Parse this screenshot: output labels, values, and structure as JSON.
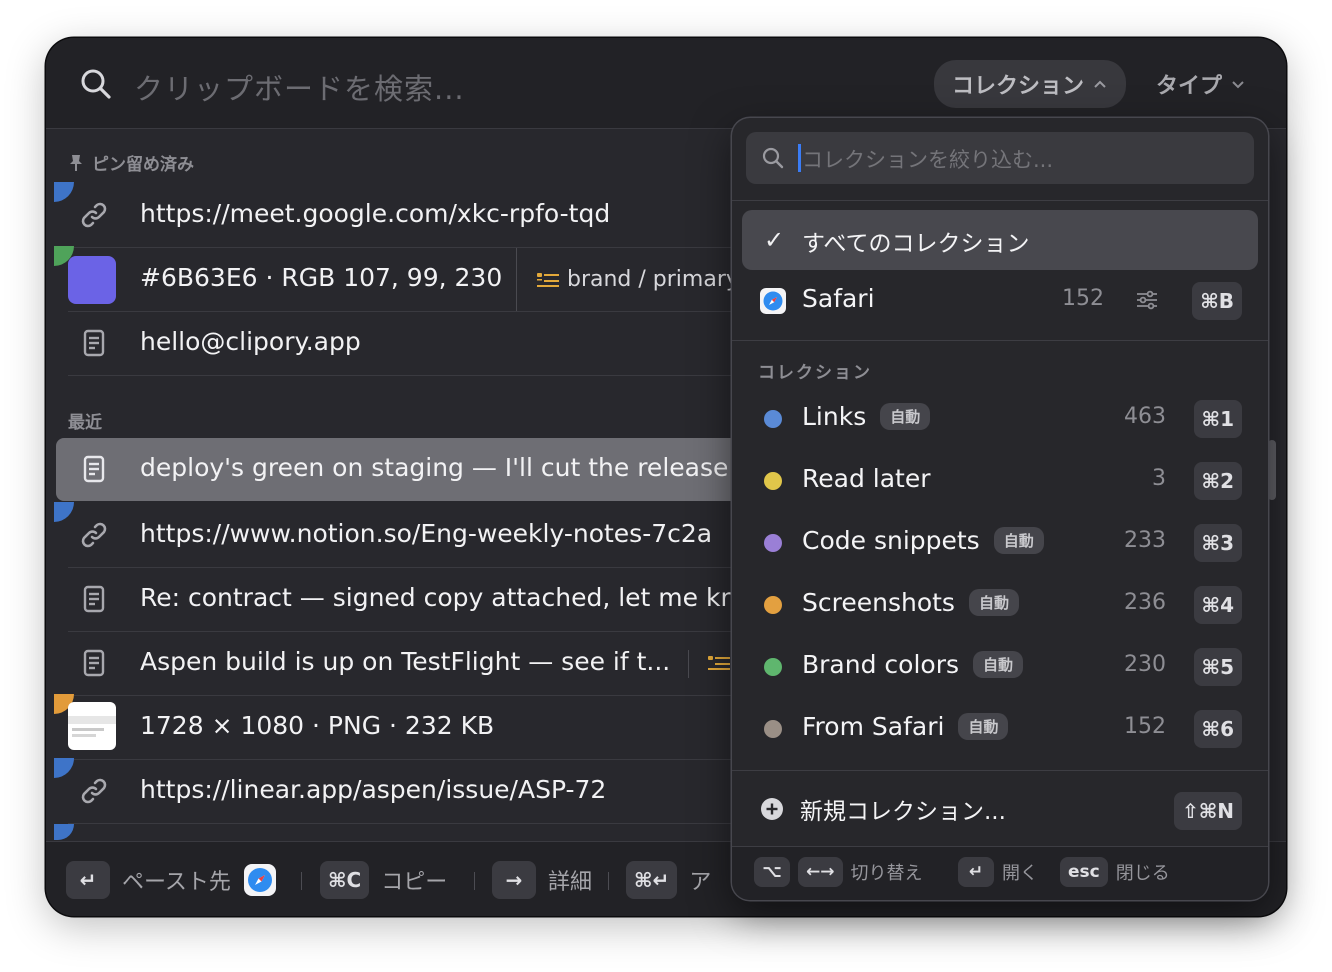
{
  "search": {
    "placeholder": "クリップボードを検索..."
  },
  "header": {
    "collection_label": "コレクション",
    "type_label": "タイプ"
  },
  "pinned": {
    "title": "ピン留め済み",
    "items": [
      {
        "kind": "link",
        "text": "https://meet.google.com/xkc-rpfo-tqd",
        "corner_color": "#3e74c8"
      },
      {
        "kind": "color",
        "text": "#6B63E6 · RGB 107, 99, 230",
        "swatch": "#6B63E6",
        "corner_color": "#4fa35a",
        "collection": "brand / primary"
      },
      {
        "kind": "text",
        "text": "hello@clipory.app"
      }
    ]
  },
  "recent": {
    "title": "最近",
    "items": [
      {
        "kind": "text",
        "text": "deploy's green on staging — I'll cut the release a",
        "selected": true
      },
      {
        "kind": "link",
        "text": "https://www.notion.so/Eng-weekly-notes-7c2a",
        "corner_color": "#3e74c8"
      },
      {
        "kind": "text",
        "text": "Re: contract — signed copy attached, let me kno"
      },
      {
        "kind": "text",
        "text": "Aspen build is up on TestFlight — see if t..."
      },
      {
        "kind": "image",
        "text": "1728 × 1080 · PNG · 232 KB",
        "corner_color": "#e29b3a"
      },
      {
        "kind": "link",
        "text": "https://linear.app/aspen/issue/ASP-72",
        "corner_color": "#3e74c8"
      }
    ]
  },
  "bottombar": {
    "paste_to": "ペースト先",
    "copy_key": "⌘C",
    "copy": "コピー",
    "detail": "詳細",
    "action_key": "⌘↵",
    "action": "ア"
  },
  "dropdown": {
    "filter_placeholder": "コレクションを絞り込む...",
    "all_label": "すべてのコレクション",
    "safari": {
      "name": "Safari",
      "count": "152",
      "key": "⌘B"
    },
    "section_title": "コレクション",
    "collections": [
      {
        "name": "Links",
        "auto": "自動",
        "count": "463",
        "key": "⌘1",
        "color": "#5a8ad6"
      },
      {
        "name": "Read later",
        "auto": "",
        "count": "3",
        "key": "⌘2",
        "color": "#e0c64a"
      },
      {
        "name": "Code snippets",
        "auto": "自動",
        "count": "233",
        "key": "⌘3",
        "color": "#9a7fd6"
      },
      {
        "name": "Screenshots",
        "auto": "自動",
        "count": "236",
        "key": "⌘4",
        "color": "#e3a040"
      },
      {
        "name": "Brand colors",
        "auto": "自動",
        "count": "230",
        "key": "⌘5",
        "color": "#5fb66e"
      },
      {
        "name": "From Safari",
        "auto": "自動",
        "count": "152",
        "key": "⌘6",
        "color": "#9a8f86"
      }
    ],
    "new_collection": "新規コレクション...",
    "new_key": "⇧⌘N",
    "footer": {
      "opt_key": "⌥",
      "arrows_key": "←→",
      "switch": "切り替え",
      "enter_key": "↵",
      "open": "開く",
      "esc_key": "esc",
      "close": "閉じる"
    }
  }
}
